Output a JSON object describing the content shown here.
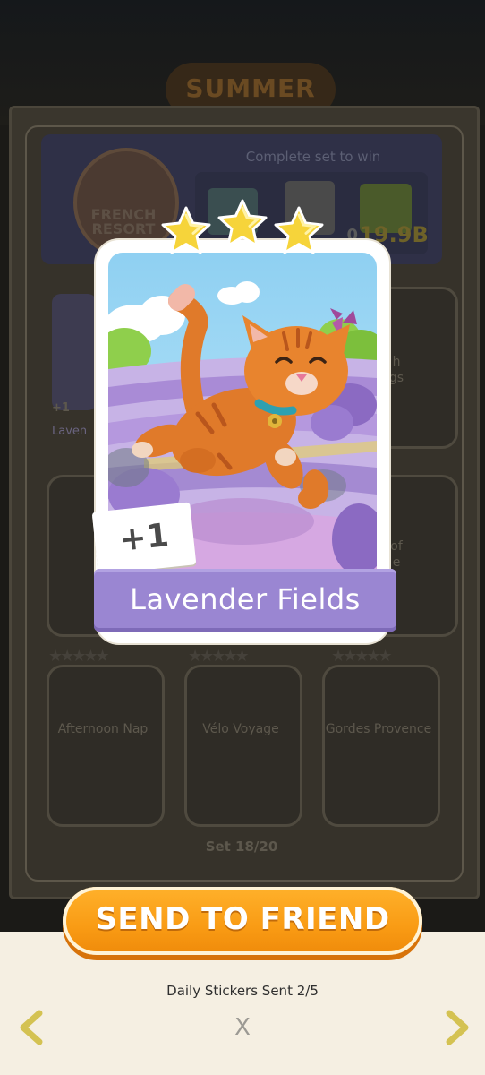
{
  "background": {
    "event_logo": "SUMMER",
    "set_badge_label": "FRENCH RESORT",
    "complete_text": "Complete set to win",
    "prize_amount": "19.9B",
    "prize_amount_small": "0",
    "set_count": "Set 18/20",
    "bg_plus": "+1",
    "bg_partial_label": "Laven",
    "slots": [
      {
        "label": "Afternoon Nap"
      },
      {
        "label": "Vélo Voyage"
      },
      {
        "label": "Gordes Provence"
      }
    ],
    "partial_labels": [
      "h",
      "gs",
      "M",
      "Ma",
      "of",
      "e"
    ]
  },
  "sticker": {
    "name": "Lavender Fields",
    "stars": 3,
    "count_badge": "+1",
    "colors": {
      "banner": "#9a86d2",
      "star": "#f6d43a",
      "cat": "#e07a2a",
      "lavender": "#b39ad8"
    }
  },
  "actions": {
    "send_label": "SEND TO FRIEND",
    "daily_sent": "Daily Stickers Sent 2/5",
    "close_glyph": "X"
  }
}
